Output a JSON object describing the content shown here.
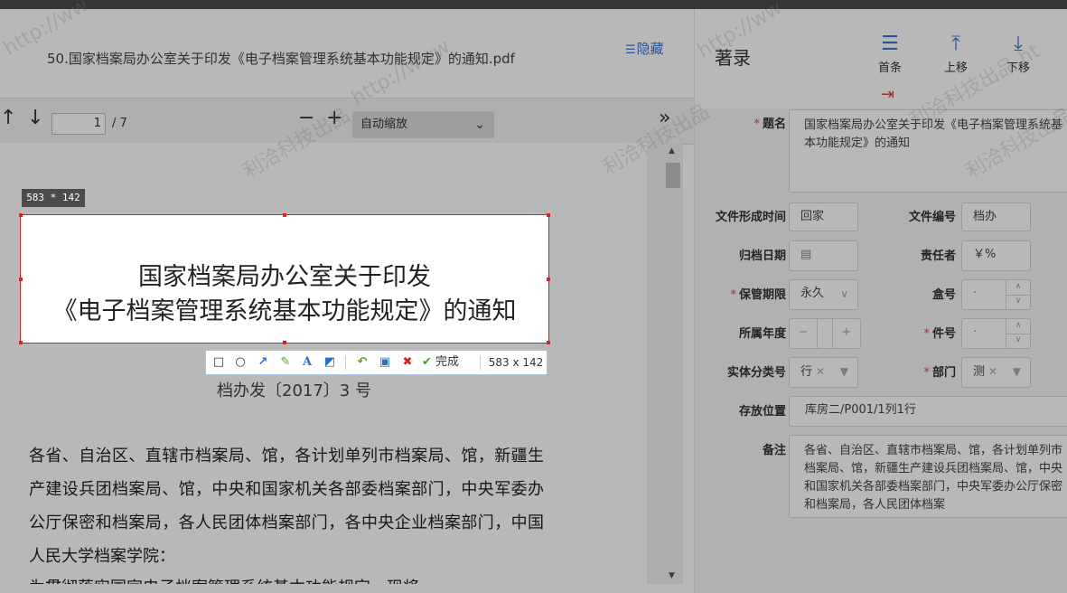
{
  "pdf": {
    "filename": "50.国家档案局办公室关于印发《电子档案管理系统基本功能规定》的通知.pdf",
    "hide_label": "隐藏",
    "toolbar": {
      "current_page": "1",
      "total_pages": "/ 7",
      "zoom": "自动缩放"
    },
    "page": {
      "title_line1": "国家档案局办公室关于印发",
      "title_line2": "《电子档案管理系统基本功能规定》的通知",
      "doc_number": "档办发〔2017〕3 号",
      "body": "各省、自治区、直辖市档案局、馆，各计划单列市档案局、馆，新疆生产建设兵团档案局、馆，中央和国家机关各部委档案部门，中央军委办公厅保密和档案局，各人民团体档案部门，各中央企业档案部门，中国人民大学档案学院：",
      "next_line": "为贯彻落实国家电子档案管理系统基本功能规定，现将"
    }
  },
  "screenshot_tool": {
    "size_tag": "583 * 142",
    "size_label": "583 x 142",
    "done_label": "完成"
  },
  "catalog": {
    "title": "著录",
    "nav": {
      "first": "首条",
      "prev": "上移",
      "next": "下移"
    },
    "fields": {
      "title_label": "题名",
      "title_value": "国家档案局办公室关于印发《电子档案管理系统基本功能规定》的通知",
      "form_time_label": "文件形成时间",
      "form_time_value": "回家",
      "doc_no_label": "文件编号",
      "doc_no_value": "档办",
      "archive_date_label": "归档日期",
      "responsible_label": "责任者",
      "responsible_value": "￥%",
      "retention_label": "保管期限",
      "retention_value": "永久",
      "box_label": "盒号",
      "box_value": "·",
      "year_label": "所属年度",
      "item_no_label": "件号",
      "item_no_value": "·",
      "entity_label": "实体分类号",
      "entity_value": "行",
      "dept_label": "部门",
      "dept_value": "测",
      "location_label": "存放位置",
      "location_value": "库房二/P001/1列1行",
      "remarks_label": "备注",
      "remarks_value": "各省、自治区、直辖市档案局、馆，各计划单列市档案局、馆，新疆生产建设兵团档案局、馆，中央和国家机关各部委档案部门，中央军委办公厅保密和档案局，各人民团体档案"
    }
  },
  "watermarks": {
    "w1": "http://ww",
    "w2": "http://www",
    "w3": "http://ww",
    "w4": "利洽科技出品",
    "w5": "利洽科技出品",
    "w6": "利洽科技出品 ht",
    "w7": "利洽科技出品"
  }
}
